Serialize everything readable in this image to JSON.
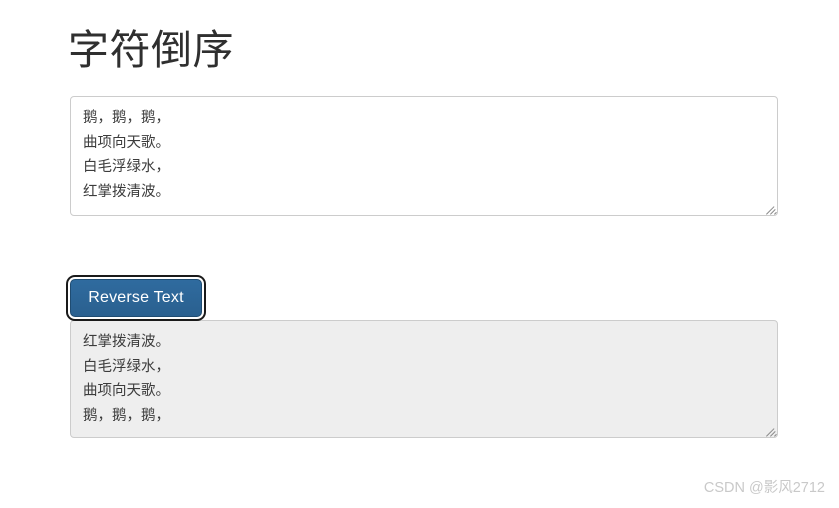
{
  "page": {
    "title": "字符倒序",
    "background_color": "#ffffff"
  },
  "input": {
    "name": "source-text",
    "value": "鹅，鹅，鹅，\n曲项向天歌。\n白毛浮绿水，\n红掌拨清波。",
    "placeholder": "",
    "background_color": "#ffffff",
    "border_color": "#cccccc",
    "readonly": false
  },
  "button": {
    "label": "Reverse Text",
    "background_color": "#2b6395",
    "text_color": "#ffffff",
    "focused": true,
    "focus_ring_color": "#1a1a1a"
  },
  "output": {
    "name": "reversed-text",
    "value": "红掌拨清波。\n白毛浮绿水，\n曲项向天歌。\n鹅，鹅，鹅，",
    "placeholder": "",
    "background_color": "#eeeeee",
    "border_color": "#cccccc",
    "readonly": true
  },
  "icons": {
    "resize_grip": "resize-grip-icon"
  },
  "watermark": {
    "text": "CSDN @影风2712",
    "color": "#c9c9c9"
  }
}
